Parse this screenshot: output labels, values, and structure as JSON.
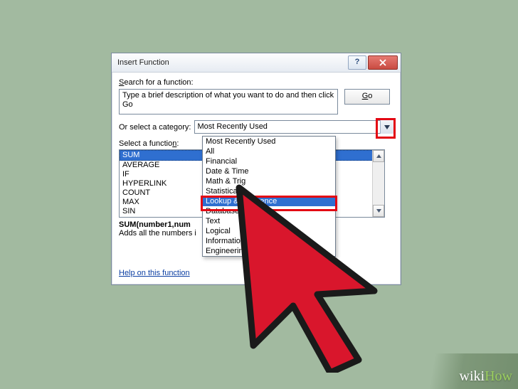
{
  "dialog": {
    "title": "Insert Function",
    "search_label_pre": "S",
    "search_label_rest": "earch for a function:",
    "search_text": "Type a brief description of what you want to do and then click Go",
    "go_label": "Go",
    "category_label": "Or select a category:",
    "category_selected": "Most Recently Used",
    "funclist_label_pre": "Select a functio",
    "funclist_label_u": "n",
    "funclist_label_post": ":",
    "functions": [
      "SUM",
      "AVERAGE",
      "IF",
      "HYPERLINK",
      "COUNT",
      "MAX",
      "SIN"
    ],
    "signature": "SUM(number1,num",
    "description": "Adds all the numbers i",
    "help_link": "Help on this function"
  },
  "dropdown": {
    "items": [
      "Most Recently Used",
      "All",
      "Financial",
      "Date & Time",
      "Math & Trig",
      "Statistical",
      "Lookup & Reference",
      "Database",
      "Text",
      "Logical",
      "Information",
      "Engineering"
    ],
    "highlighted_index": 6
  },
  "watermark": {
    "wiki": "wiki",
    "how": "How"
  }
}
